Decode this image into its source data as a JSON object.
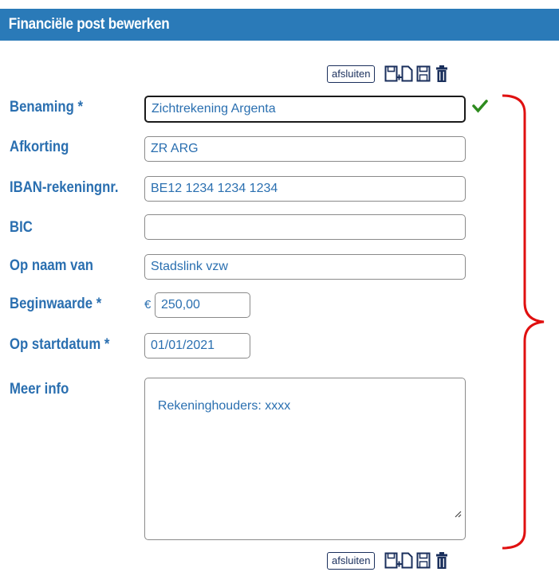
{
  "header": {
    "title": "Financiële post bewerken"
  },
  "toolbar": {
    "close_label": "afsluiten",
    "icons": [
      "save-new-icon",
      "save-icon",
      "delete-icon"
    ]
  },
  "form": {
    "benaming": {
      "label": "Benaming *",
      "value": "Zichtrekening Argenta"
    },
    "afkorting": {
      "label": "Afkorting",
      "value": "ZR ARG"
    },
    "iban": {
      "label": "IBAN-rekeningnr.",
      "value": "BE12 1234 1234 1234"
    },
    "bic": {
      "label": "BIC",
      "value": ""
    },
    "op_naam_van": {
      "label": "Op naam van",
      "value": "Stadslink vzw"
    },
    "beginwaarde": {
      "label": "Beginwaarde *",
      "currency": "€",
      "value": "250,00"
    },
    "op_startdatum": {
      "label": "Op startdatum *",
      "value": "01/01/2021"
    },
    "meer_info": {
      "label": "Meer info",
      "value": "Rekeninghouders: xxxx"
    }
  },
  "colors": {
    "header_bg": "#2a7ab8",
    "label": "#2a6fb0",
    "valid": "#2e8b1e",
    "bracket": "#e01010"
  }
}
